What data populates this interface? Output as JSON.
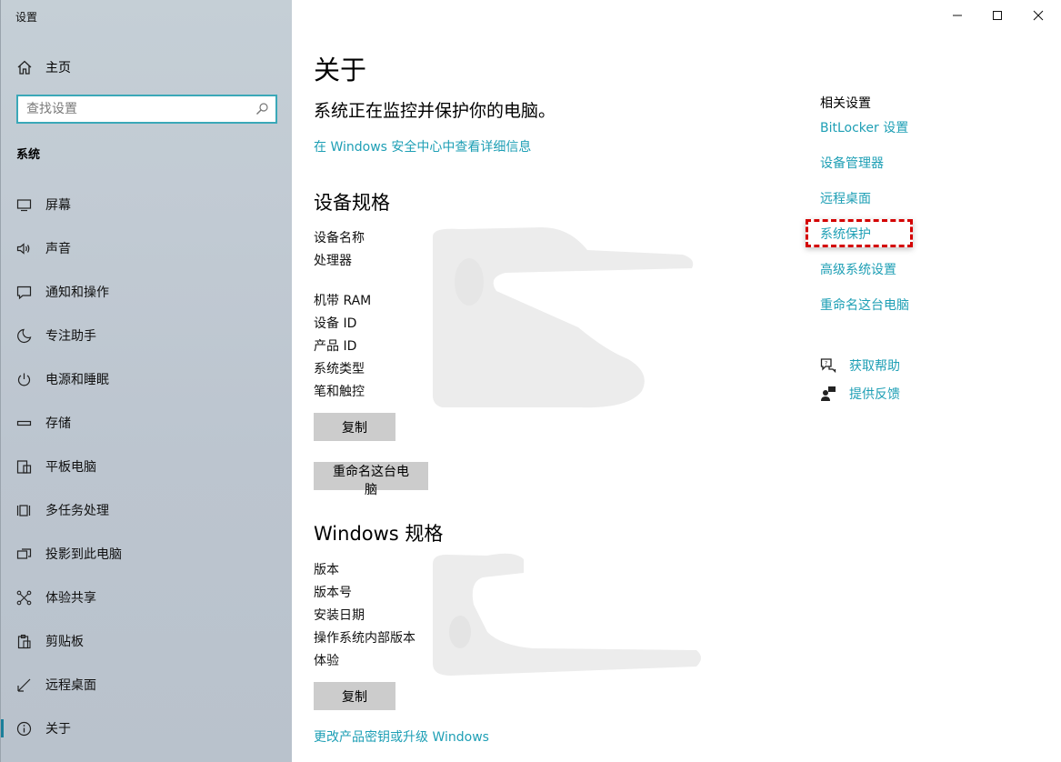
{
  "window": {
    "title": "设置"
  },
  "sidebar": {
    "home_label": "主页",
    "search_placeholder": "查找设置",
    "section_label": "系统",
    "items": [
      {
        "label": "屏幕",
        "icon": "monitor-icon"
      },
      {
        "label": "声音",
        "icon": "speaker-icon"
      },
      {
        "label": "通知和操作",
        "icon": "notification-icon"
      },
      {
        "label": "专注助手",
        "icon": "moon-icon"
      },
      {
        "label": "电源和睡眠",
        "icon": "power-icon"
      },
      {
        "label": "存储",
        "icon": "storage-icon"
      },
      {
        "label": "平板电脑",
        "icon": "tablet-icon"
      },
      {
        "label": "多任务处理",
        "icon": "multitask-icon"
      },
      {
        "label": "投影到此电脑",
        "icon": "project-icon"
      },
      {
        "label": "体验共享",
        "icon": "share-icon"
      },
      {
        "label": "剪贴板",
        "icon": "clipboard-icon"
      },
      {
        "label": "远程桌面",
        "icon": "remote-icon"
      },
      {
        "label": "关于",
        "icon": "info-icon",
        "active": true
      }
    ]
  },
  "main": {
    "title": "关于",
    "protection_text": "系统正在监控并保护你的电脑。",
    "security_link": "在 Windows 安全中心中查看详细信息",
    "device_specs": {
      "heading": "设备规格",
      "labels": [
        "设备名称",
        "处理器",
        "机带 RAM",
        "设备 ID",
        "产品 ID",
        "系统类型",
        "笔和触控"
      ],
      "copy_button": "复制",
      "rename_button": "重命名这台电脑"
    },
    "windows_specs": {
      "heading": "Windows 规格",
      "labels": [
        "版本",
        "版本号",
        "安装日期",
        "操作系统内部版本",
        "体验"
      ],
      "copy_button": "复制",
      "change_key_link": "更改产品密钥或升级 Windows"
    }
  },
  "related": {
    "title": "相关设置",
    "links": [
      "BitLocker 设置",
      "设备管理器",
      "远程桌面",
      "系统保护",
      "高级系统设置",
      "重命名这台电脑"
    ],
    "highlighted": "系统保护",
    "help_label": "获取帮助",
    "feedback_label": "提供反馈"
  },
  "colors": {
    "accent_link": "#1e9fb5",
    "highlight_border": "#d40000"
  }
}
